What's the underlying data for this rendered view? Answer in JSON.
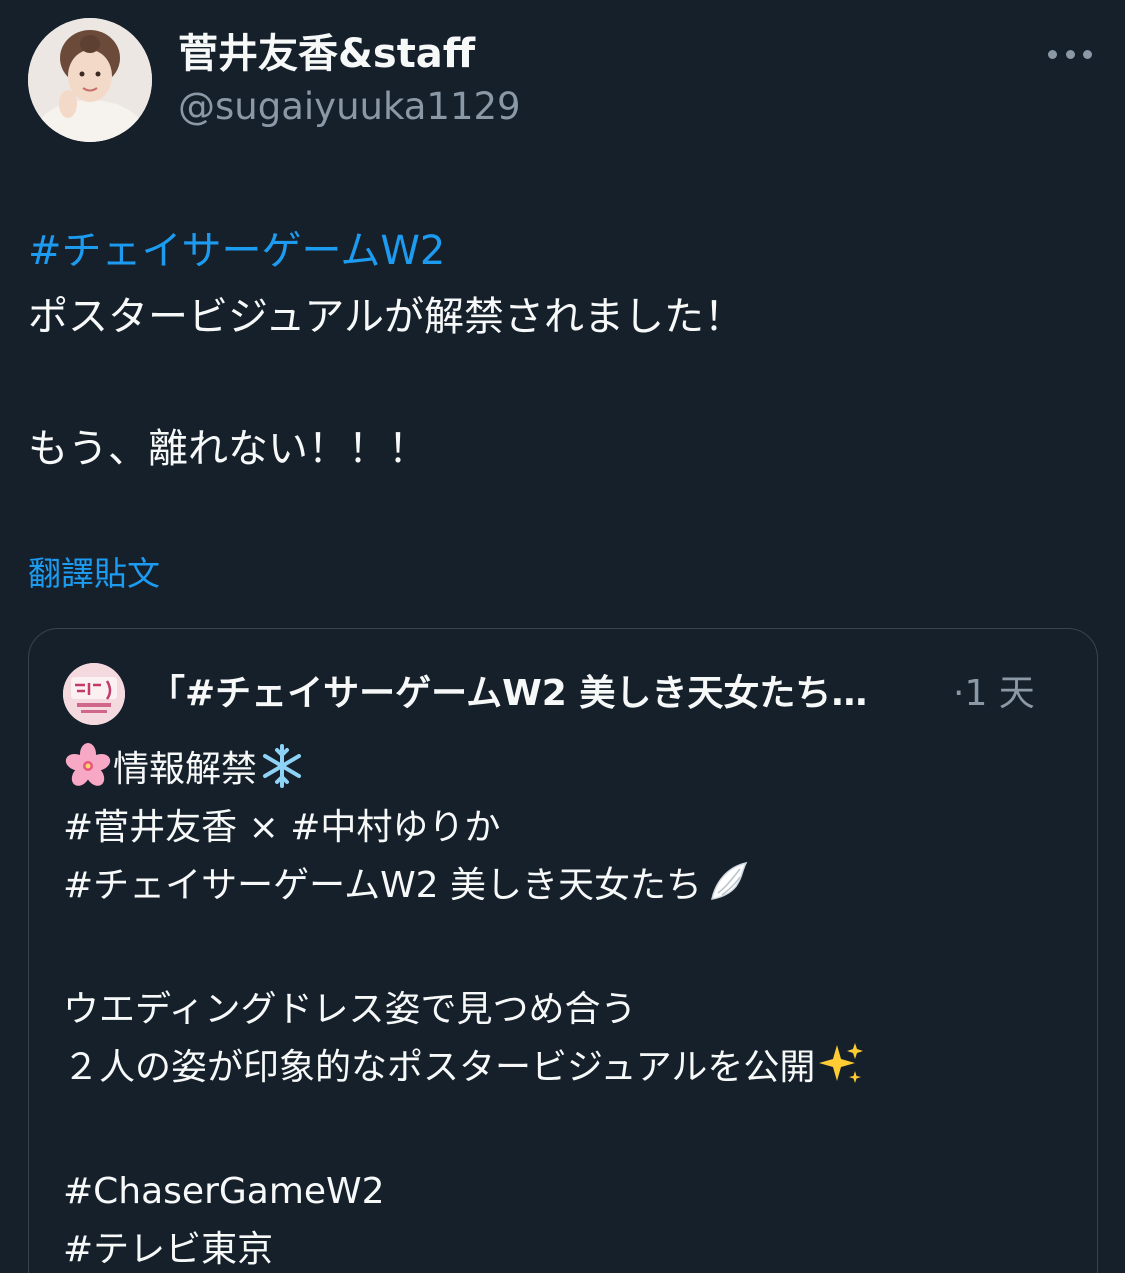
{
  "author": {
    "display_name": "菅井友香&staff",
    "handle": "@sugaiyuuka1129"
  },
  "tweet": {
    "hashtag": "#チェイサーゲームW2",
    "line2": "ポスタービジュアルが解禁されました！",
    "line3": "もう、離れない！！！"
  },
  "translate_label": "翻譯貼文",
  "quote": {
    "name": "「#チェイサーゲームW2 美しき天女たち…",
    "time": "·1 天",
    "lines": {
      "l1": "情報解禁",
      "l2a": "#菅井友香",
      "l2b": " × ",
      "l2c": "#中村ゆりか",
      "l3a": "#チェイサーゲームW2",
      "l3b": " 美しき天女たち",
      "l4": "ウエディングドレス姿で見つめ合う",
      "l5": "２人の姿が印象的なポスタービジュアルを公開",
      "l6": "#ChaserGameW2",
      "l7": "#テレビ東京"
    }
  },
  "colors": {
    "background": "#15202b",
    "text": "#f7f9f9",
    "secondary": "#8b98a5",
    "link": "#1d9bf0",
    "border": "#38444d"
  },
  "icons": [
    "more-icon",
    "cherry-blossom-icon",
    "snowflake-icon",
    "wing-icon",
    "sparkles-icon"
  ]
}
